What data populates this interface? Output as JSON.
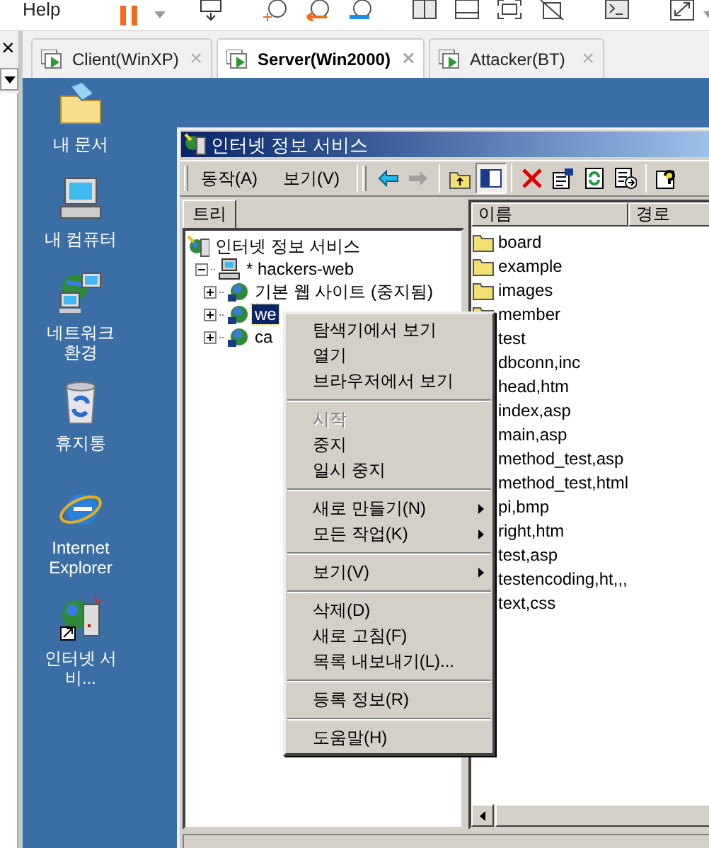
{
  "toolbar": {
    "menu": "Help"
  },
  "side_panel": {
    "close": "×"
  },
  "tabs": [
    {
      "label": "Client(WinXP)",
      "close": "×",
      "selected": false
    },
    {
      "label": "Server(Win2000)",
      "close": "×",
      "selected": true
    },
    {
      "label": "Attacker(BT)",
      "close": "×",
      "selected": false
    }
  ],
  "desktop_icons": [
    {
      "label": "내 문서",
      "kind": "documents"
    },
    {
      "label": "내 컴퓨터",
      "kind": "computer"
    },
    {
      "label": "네트워크 환경",
      "kind": "network"
    },
    {
      "label": "휴지통",
      "kind": "recycle"
    },
    {
      "label": "Internet Explorer",
      "kind": "browser"
    },
    {
      "label": "인터넷 서비...",
      "kind": "server"
    }
  ],
  "mmc": {
    "title": "인터넷 정보 서비스",
    "menus": [
      "동작(A)",
      "보기(V)"
    ],
    "tree_tab": "트리",
    "tree": [
      {
        "label": "인터넷 정보 서비스",
        "kind": "services",
        "selected": false,
        "children": [
          {
            "label": "* hackers-web",
            "kind": "computer",
            "selected": false,
            "expanded": true,
            "children": [
              {
                "label": "기본 웹 사이트 (중지됨)",
                "kind": "site",
                "selected": false,
                "expanded": false
              },
              {
                "label": "we",
                "kind": "site",
                "selected": true,
                "expanded": false
              },
              {
                "label": "ca",
                "kind": "site",
                "selected": false,
                "expanded": false
              }
            ]
          }
        ]
      }
    ],
    "list": {
      "columns": [
        "이름",
        "경로"
      ],
      "rows": [
        {
          "name": "board",
          "kind": "folder"
        },
        {
          "name": "example",
          "kind": "folder"
        },
        {
          "name": "images",
          "kind": "folder"
        },
        {
          "name": "member",
          "kind": "folder"
        },
        {
          "name": "test",
          "kind": "file"
        },
        {
          "name": "dbconn,inc",
          "kind": "file"
        },
        {
          "name": "head,htm",
          "kind": "file"
        },
        {
          "name": "index,asp",
          "kind": "file"
        },
        {
          "name": "main,asp",
          "kind": "file"
        },
        {
          "name": "method_test,asp",
          "kind": "file"
        },
        {
          "name": "method_test,html",
          "kind": "file"
        },
        {
          "name": "pi,bmp",
          "kind": "file"
        },
        {
          "name": "right,htm",
          "kind": "file"
        },
        {
          "name": "test,asp",
          "kind": "file"
        },
        {
          "name": "testencoding,ht,,,",
          "kind": "file"
        },
        {
          "name": "text,css",
          "kind": "file"
        }
      ]
    }
  },
  "context_menu": {
    "groups": [
      [
        {
          "label": "탐색기에서 보기",
          "disabled": false,
          "submenu": false
        },
        {
          "label": "열기",
          "disabled": false,
          "submenu": false
        },
        {
          "label": "브라우저에서 보기",
          "disabled": false,
          "submenu": false
        }
      ],
      [
        {
          "label": "시작",
          "disabled": true,
          "submenu": false
        },
        {
          "label": "중지",
          "disabled": false,
          "submenu": false
        },
        {
          "label": "일시 중지",
          "disabled": false,
          "submenu": false
        }
      ],
      [
        {
          "label": "새로 만들기(N)",
          "disabled": false,
          "submenu": true
        },
        {
          "label": "모든 작업(K)",
          "disabled": false,
          "submenu": true
        }
      ],
      [
        {
          "label": "보기(V)",
          "disabled": false,
          "submenu": true
        }
      ],
      [
        {
          "label": "삭제(D)",
          "disabled": false,
          "submenu": false
        },
        {
          "label": "새로 고침(F)",
          "disabled": false,
          "submenu": false
        },
        {
          "label": "목록 내보내기(L)...",
          "disabled": false,
          "submenu": false
        }
      ],
      [
        {
          "label": "등록 정보(R)",
          "disabled": false,
          "submenu": false
        }
      ],
      [
        {
          "label": "도움말(H)",
          "disabled": false,
          "submenu": false
        }
      ]
    ]
  }
}
